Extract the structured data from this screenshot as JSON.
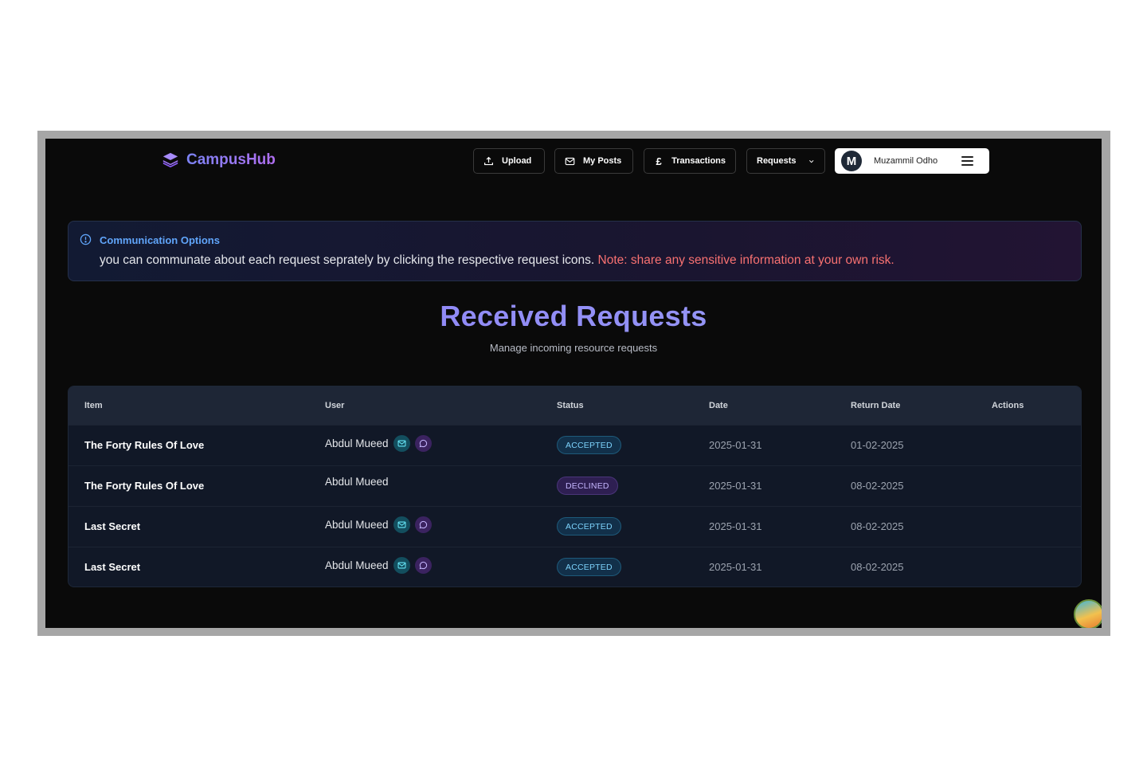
{
  "app": {
    "name": "CampusHub"
  },
  "nav": {
    "upload": "Upload",
    "my_posts": "My Posts",
    "transactions": "Transactions",
    "requests": "Requests"
  },
  "user": {
    "initial": "M",
    "name": "Muzammil Odho"
  },
  "alert": {
    "title": "Communication Options",
    "text": "you can communate about each request seprately by clicking the respective request icons.",
    "note": "Note: share any sensitive information at your own risk."
  },
  "page": {
    "title": "Received Requests",
    "subtitle": "Manage incoming resource requests"
  },
  "table": {
    "headers": {
      "item": "Item",
      "user": "User",
      "status": "Status",
      "date": "Date",
      "return_date": "Return Date",
      "actions": "Actions"
    },
    "rows": [
      {
        "item": "The Forty Rules Of Love",
        "user": "Abdul Mueed",
        "status": "ACCEPTED",
        "date": "2025-01-31",
        "return_date": "01-02-2025"
      },
      {
        "item": "The Forty Rules Of Love",
        "user": "Abdul Mueed",
        "status": "DECLINED",
        "date": "2025-01-31",
        "return_date": "08-02-2025"
      },
      {
        "item": "Last Secret",
        "user": "Abdul Mueed",
        "status": "ACCEPTED",
        "date": "2025-01-31",
        "return_date": "08-02-2025"
      },
      {
        "item": "Last Secret",
        "user": "Abdul Mueed",
        "status": "ACCEPTED",
        "date": "2025-01-31",
        "return_date": "08-02-2025"
      }
    ]
  },
  "colors": {
    "accent": "#8b7cf6",
    "link": "#60a5fa",
    "warning": "#f87171",
    "background": "#0a0a0a"
  }
}
